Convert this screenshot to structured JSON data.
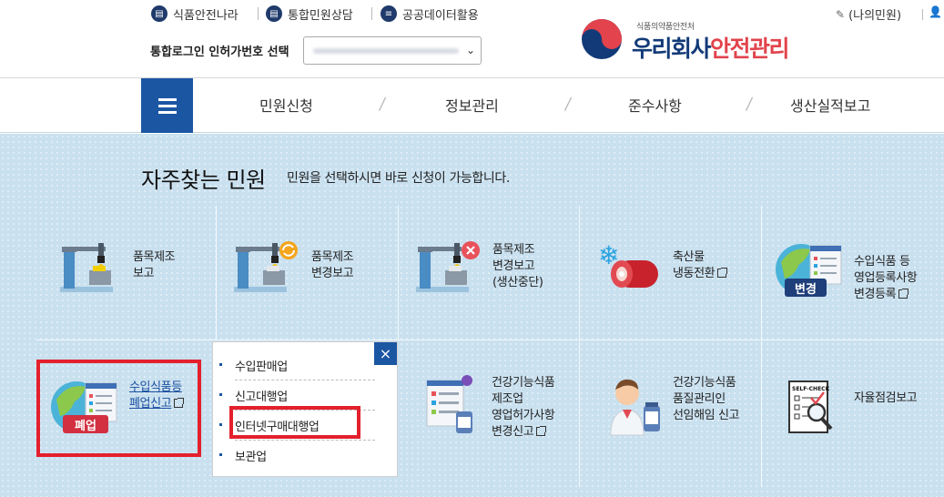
{
  "header": {
    "util_links": [
      "식품안전나라",
      "통합민원상담",
      "공공데이터활용"
    ],
    "login_label": "통합로그인 인허가번호 선택",
    "agency": "식품의약품안전처",
    "brand_part1": "우리회사",
    "brand_part2": "안전관리",
    "my_app": "(나의민원)"
  },
  "gnb": {
    "menu_items": [
      "민원신청",
      "정보관리",
      "준수사항",
      "생산실적보고"
    ]
  },
  "main": {
    "title": "자주찾는 민원",
    "description": "민원을 선택하시면 바로 신청이 가능합니다.",
    "row1": [
      {
        "lines": [
          "품목제조",
          "보고"
        ]
      },
      {
        "lines": [
          "품목제조",
          "변경보고"
        ]
      },
      {
        "lines": [
          "품목제조",
          "변경보고",
          "(생산중단)"
        ]
      },
      {
        "lines": [
          "축산물",
          "냉동전환"
        ]
      },
      {
        "lines": [
          "수입식품 등",
          "영업등록사항",
          "변경등록"
        ],
        "badge": "변경"
      }
    ],
    "row2": [
      {
        "lines": [
          "수입식품등",
          "폐업신고"
        ],
        "badge": "폐업"
      },
      {
        "lines": [
          "건강기능식품",
          "제조업",
          "영업허가사항",
          "변경신고"
        ]
      },
      {
        "lines": [
          "건강기능식품",
          "품질관리인",
          "선임해임 신고"
        ]
      },
      {
        "lines": [
          "자율점검보고"
        ]
      }
    ],
    "self_check_text": "SELF-CHECK"
  },
  "popup": {
    "close_icon": "×",
    "items": [
      "수입판매업",
      "신고대행업",
      "인터넷구매대행업",
      "보관업"
    ]
  },
  "colors": {
    "brand_blue": "#1b56a3",
    "highlight_red": "#e3202c",
    "bg": "#c9e0ef"
  }
}
